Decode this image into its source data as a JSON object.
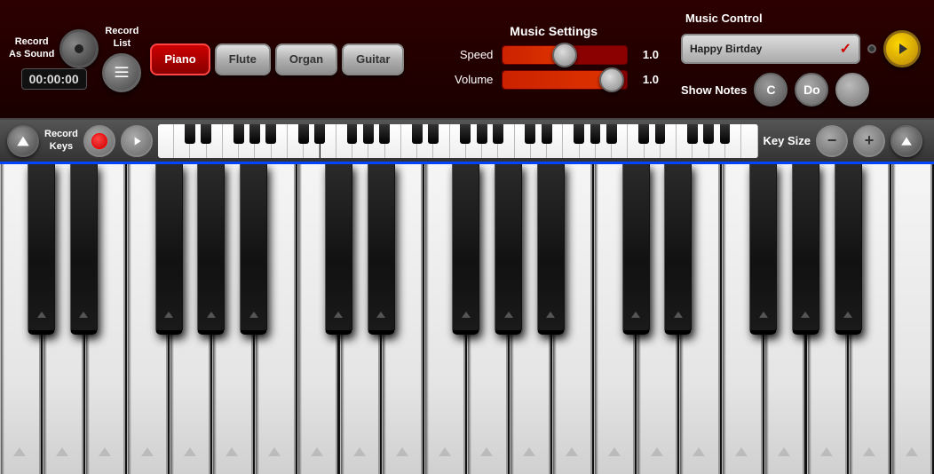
{
  "topBar": {
    "recordAsSound": {
      "line1": "Record",
      "line2": "As Sound"
    },
    "timer": "00:00:00",
    "recordList": {
      "line1": "Record",
      "line2": "List"
    },
    "instruments": [
      {
        "id": "piano",
        "label": "Piano",
        "active": true
      },
      {
        "id": "flute",
        "label": "Flute",
        "active": false
      },
      {
        "id": "organ",
        "label": "Organ",
        "active": false
      },
      {
        "id": "guitar",
        "label": "Guitar",
        "active": false
      }
    ]
  },
  "musicSettings": {
    "title": "Music Settings",
    "speed": {
      "label": "Speed",
      "value": "1.0",
      "fillPercent": 50
    },
    "volume": {
      "label": "Volume",
      "value": "1.0",
      "fillPercent": 90
    }
  },
  "musicControl": {
    "title": "Music Control",
    "songName": "Happy Birtday",
    "showNotes": "Show Notes",
    "cNote": "C",
    "doNote": "Do"
  },
  "recordKeysBar": {
    "line1": "Record",
    "line2": "Keys",
    "keySize": "Key Size"
  },
  "piano": {
    "whiteKeys": 22,
    "blackKeyPositions": [
      1,
      2,
      4,
      5,
      6,
      8,
      9,
      11,
      12,
      13,
      15,
      16,
      18,
      19,
      20
    ]
  }
}
